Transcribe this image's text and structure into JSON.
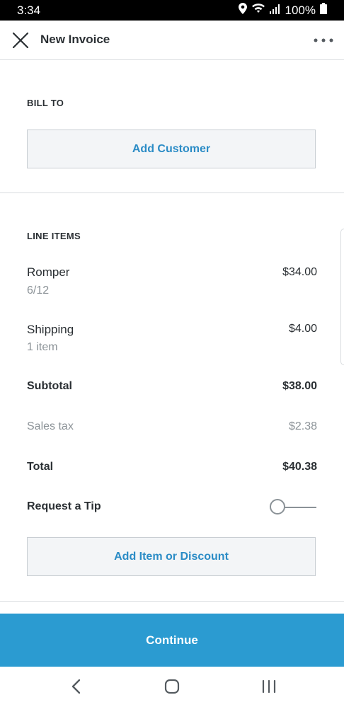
{
  "status_bar": {
    "time": "3:34",
    "battery": "100%",
    "icons": [
      "location-icon",
      "wifi-icon",
      "signal-icon",
      "battery-icon"
    ]
  },
  "app_bar": {
    "title": "New Invoice",
    "close_icon": "close-icon",
    "more_icon": "more-horizontal-icon"
  },
  "bill_to": {
    "label": "BILL TO",
    "add_customer_label": "Add Customer"
  },
  "line_items": {
    "label": "LINE ITEMS",
    "items": [
      {
        "name": "Romper",
        "detail": "6/12",
        "price": "$34.00"
      },
      {
        "name": "Shipping",
        "detail": "1 item",
        "price": "$4.00"
      }
    ],
    "subtotal_label": "Subtotal",
    "subtotal_value": "$38.00",
    "tax_label": "Sales tax",
    "tax_value": "$2.38",
    "total_label": "Total",
    "total_value": "$40.38"
  },
  "tip": {
    "label": "Request a Tip",
    "enabled": false
  },
  "add_item_label": "Add Item or Discount",
  "continue_label": "Continue",
  "nav_bar": {
    "icons": [
      "back-icon",
      "home-icon",
      "recents-icon"
    ]
  },
  "colors": {
    "accent": "#2b9bd1",
    "link": "#2b8cc6",
    "text": "#2a2f33",
    "muted": "#8b9297"
  }
}
